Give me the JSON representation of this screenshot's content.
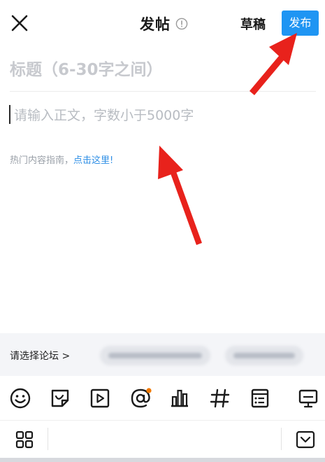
{
  "header": {
    "title": "发帖",
    "draft_label": "草稿",
    "publish_label": "发布"
  },
  "editor": {
    "title_placeholder": "标题（6-30字之间）",
    "body_placeholder": "请输入正文，字数小于5000字",
    "hint_text": "热门内容指南，",
    "hint_link": "点击这里!"
  },
  "forum": {
    "select_label": "请选择论坛 >"
  },
  "toolbar": {
    "icons": [
      "emoji-icon",
      "sticker-icon",
      "video-icon",
      "mention-icon",
      "chart-icon",
      "hashtag-icon",
      "table-icon",
      "keyboard-hide-icon"
    ]
  },
  "colors": {
    "accent": "#1f95f3",
    "link": "#2f8fe6",
    "annotation_arrow": "#e8221c",
    "notification_dot": "#f07800"
  }
}
